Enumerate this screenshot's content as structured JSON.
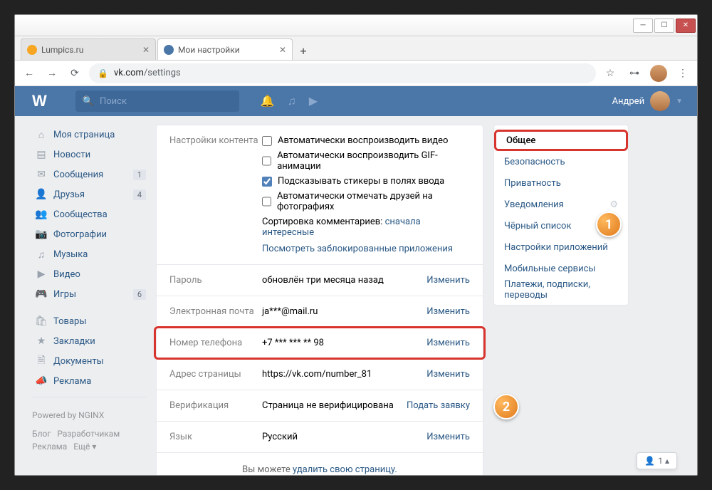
{
  "browser": {
    "tabs": [
      {
        "title": "Lumpics.ru",
        "active": false
      },
      {
        "title": "Мои настройки",
        "active": true
      }
    ],
    "url_host": "vk.com",
    "url_path": "/settings"
  },
  "vk_header": {
    "search_placeholder": "Поиск",
    "user_name": "Андрей"
  },
  "nav": {
    "items": [
      {
        "icon": "⌂",
        "label": "Моя страница",
        "badge": ""
      },
      {
        "icon": "▤",
        "label": "Новости",
        "badge": ""
      },
      {
        "icon": "✉",
        "label": "Сообщения",
        "badge": "1"
      },
      {
        "icon": "👤",
        "label": "Друзья",
        "badge": "4"
      },
      {
        "icon": "👥",
        "label": "Сообщества",
        "badge": ""
      },
      {
        "icon": "📷",
        "label": "Фотографии",
        "badge": ""
      },
      {
        "icon": "♫",
        "label": "Музыка",
        "badge": ""
      },
      {
        "icon": "▶",
        "label": "Видео",
        "badge": ""
      },
      {
        "icon": "🎮",
        "label": "Игры",
        "badge": "6"
      }
    ],
    "items2": [
      {
        "icon": "🛍",
        "label": "Товары"
      },
      {
        "icon": "★",
        "label": "Закладки"
      },
      {
        "icon": "🗎",
        "label": "Документы"
      },
      {
        "icon": "📣",
        "label": "Реклама"
      }
    ],
    "powered": "Powered by NGINX",
    "footer": {
      "blog": "Блог",
      "devs": "Разработчикам",
      "ads": "Реклама",
      "more": "Ещё ▾"
    }
  },
  "settings": {
    "content_label": "Настройки контента",
    "checks": {
      "c1": {
        "label": "Автоматически воспроизводить видео",
        "checked": false
      },
      "c2": {
        "label": "Автоматически воспроизводить GIF-анимации",
        "checked": false
      },
      "c3": {
        "label": "Подсказывать стикеры в полях ввода",
        "checked": true
      },
      "c4": {
        "label": "Автоматически отмечать друзей на фотографиях",
        "checked": false
      }
    },
    "sort_prefix": "Сортировка комментариев: ",
    "sort_value": "сначала интересные",
    "blocked_apps": "Посмотреть заблокированные приложения",
    "rows": {
      "password": {
        "label": "Пароль",
        "value": "обновлён три месяца назад",
        "action": "Изменить"
      },
      "email": {
        "label": "Электронная почта",
        "value": "ja***@mail.ru",
        "action": "Изменить"
      },
      "phone": {
        "label": "Номер телефона",
        "value": "+7 *** *** ** 98",
        "action": "Изменить"
      },
      "url": {
        "label": "Адрес страницы",
        "value": "https://vk.com/number_81",
        "action": "Изменить"
      },
      "verify": {
        "label": "Верификация",
        "value": "Страница не верифицирована",
        "action": "Подать заявку"
      },
      "lang": {
        "label": "Язык",
        "value": "Русский",
        "action": "Изменить"
      }
    },
    "footer_prefix": "Вы можете ",
    "footer_link": "удалить свою страницу."
  },
  "right_menu": {
    "items": [
      {
        "label": "Общее",
        "active": true
      },
      {
        "label": "Безопасность"
      },
      {
        "label": "Приватность"
      },
      {
        "label": "Уведомления",
        "gear": true
      },
      {
        "label": "Чёрный список"
      },
      {
        "label": "Настройки приложений"
      },
      {
        "label": "Мобильные сервисы"
      },
      {
        "label": "Платежи, подписки, переводы"
      }
    ]
  },
  "callouts": {
    "c1": "1",
    "c2": "2"
  },
  "small_pop": "1 ▴"
}
